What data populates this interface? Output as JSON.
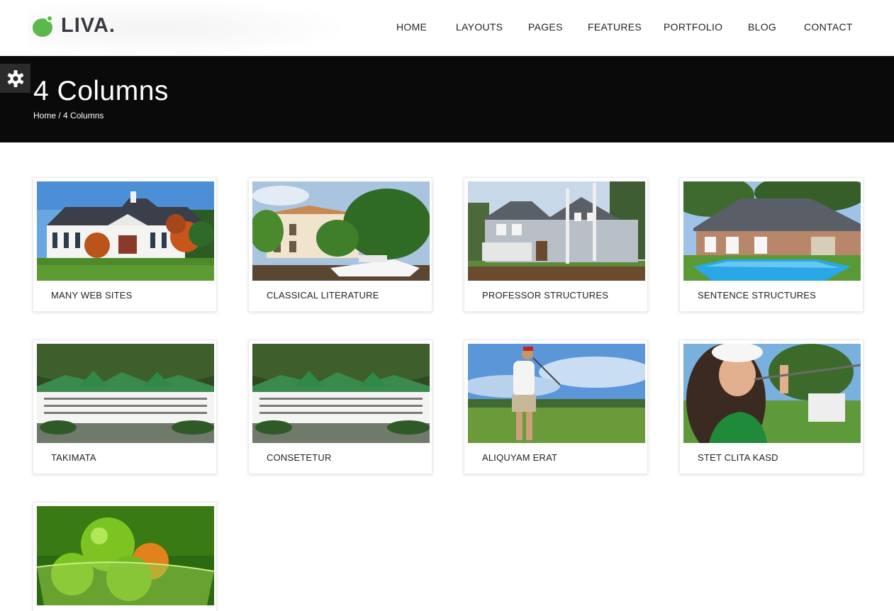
{
  "brand": {
    "name": "LIVA.",
    "accent": "#5ab94a"
  },
  "nav": [
    "HOME",
    "LAYOUTS",
    "PAGES",
    "FEATURES",
    "PORTFOLIO",
    "BLOG",
    "CONTACT"
  ],
  "page": {
    "title": "4 Columns",
    "breadcrumb_home": "Home",
    "breadcrumb_sep": "/",
    "breadcrumb_current": "4 Columns"
  },
  "settings_icon": "gear-icon",
  "portfolio": [
    {
      "label": "MANY WEB SITES",
      "image": "white-house-autumn"
    },
    {
      "label": "CLASSICAL LITERATURE",
      "image": "villa-palms-yacht"
    },
    {
      "label": "PROFESSOR STRUCTURES",
      "image": "gray-house-birches"
    },
    {
      "label": "SENTENCE STRUCTURES",
      "image": "house-pool"
    },
    {
      "label": "TAKIMATA",
      "image": "hotel-green-roofs"
    },
    {
      "label": "CONSETETUR",
      "image": "hotel-green-roofs"
    },
    {
      "label": "ALIQUYAM ERAT",
      "image": "golfer"
    },
    {
      "label": "STET CLITA KASD",
      "image": "woman-golf"
    },
    {
      "label": "",
      "image": "apples-bowl"
    }
  ]
}
